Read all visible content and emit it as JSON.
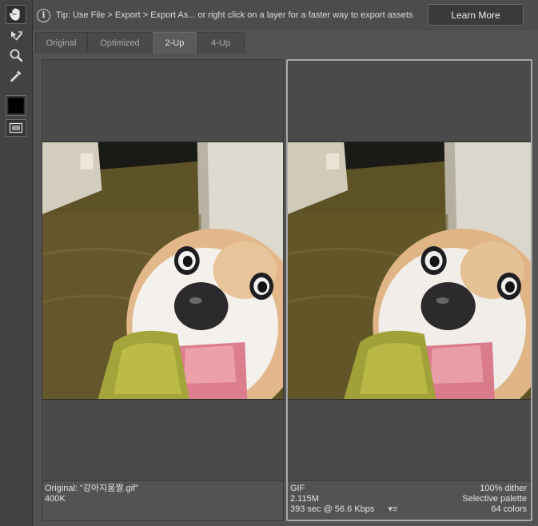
{
  "tools": [
    {
      "name": "hand-tool",
      "icon": "hand-icon",
      "active": true
    },
    {
      "name": "slice-select-tool",
      "icon": "slice-select-icon",
      "active": false
    },
    {
      "name": "zoom-tool",
      "icon": "zoom-icon",
      "active": false
    },
    {
      "name": "eyedropper-tool",
      "icon": "eyedropper-icon",
      "active": false
    }
  ],
  "eyedropper_color": "#000000",
  "tip": {
    "text": "Tip: Use File > Export > Export As...  or right click on a layer for a faster way to export assets",
    "learn_more": "Learn More"
  },
  "tabs": [
    {
      "label": "Original",
      "active": false
    },
    {
      "label": "Optimized",
      "active": false
    },
    {
      "label": "2-Up",
      "active": true
    },
    {
      "label": "4-Up",
      "active": false
    }
  ],
  "original": {
    "line1": "Original: \"강아지움짤.gif\"",
    "line2": "400K"
  },
  "optimized": {
    "format": "GIF",
    "dither": "100% dither",
    "size": "2.115M",
    "palette": "Selective palette",
    "download": "393 sec @ 56.6 Kbps",
    "colors": "64 colors",
    "menu_glyph": "▾≡"
  }
}
